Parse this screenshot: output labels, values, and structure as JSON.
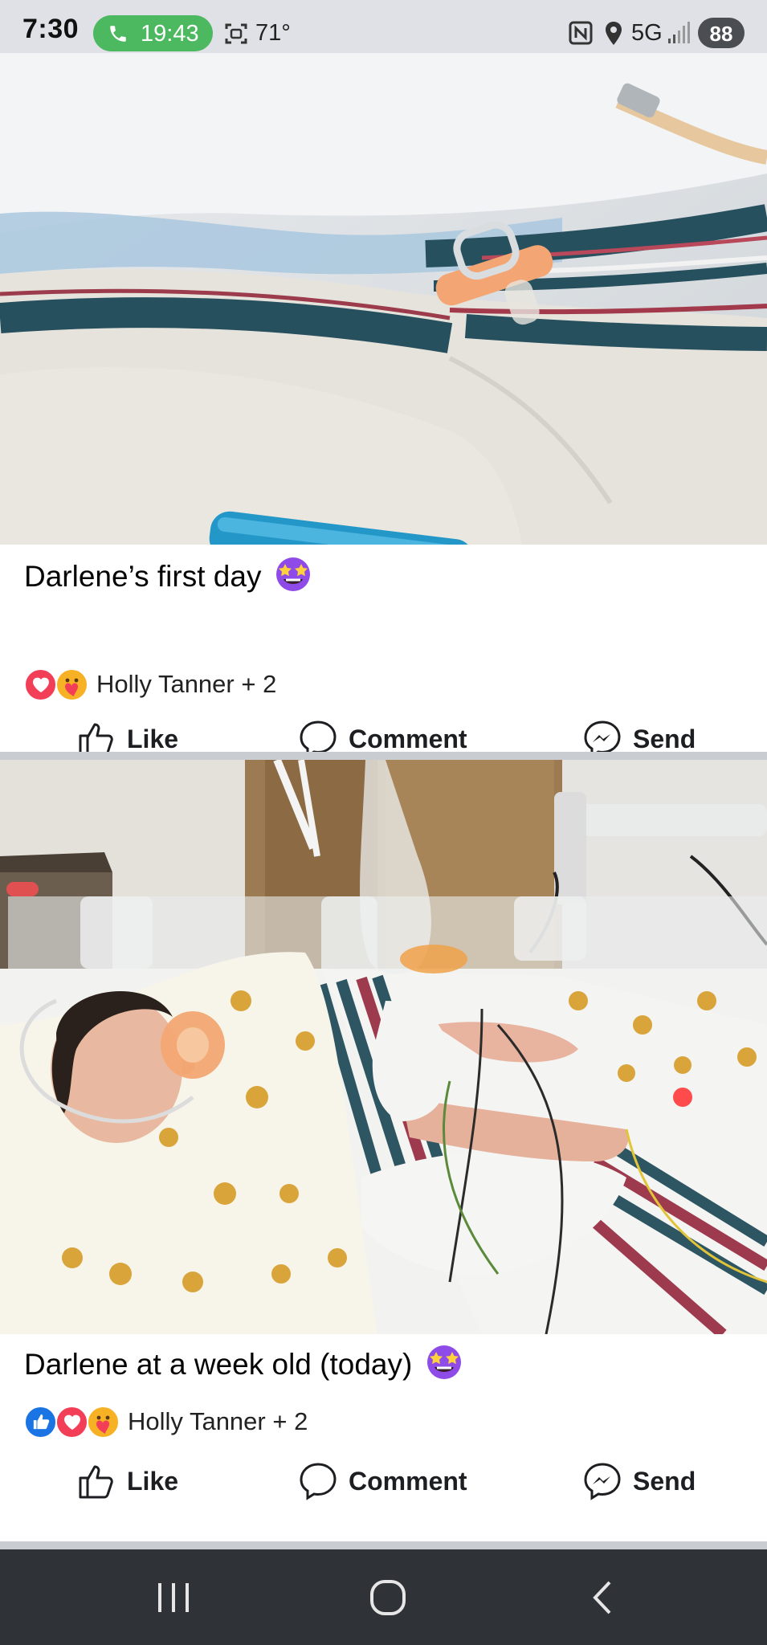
{
  "status_bar": {
    "time": "7:30",
    "call_timer": "19:43",
    "temperature": "71°",
    "network": "5G",
    "battery": "88",
    "icons": [
      "phone-icon",
      "screen-scan-icon",
      "nfc-icon",
      "location-icon",
      "signal-icon"
    ]
  },
  "posts": [
    {
      "caption": "Darlene’s first day",
      "caption_emoji": "star-struck-emoji",
      "reactions": [
        "love",
        "care"
      ],
      "reaction_names": "Holly Tanner + 2",
      "actions": {
        "like": "Like",
        "comment": "Comment",
        "send": "Send"
      }
    },
    {
      "caption": "Darlene at a week old (today)",
      "caption_emoji": "star-struck-emoji",
      "reactions": [
        "like",
        "love",
        "care"
      ],
      "reaction_names": "Holly Tanner + 2",
      "actions": {
        "like": "Like",
        "comment": "Comment",
        "send": "Send"
      }
    }
  ],
  "nav_bar": {
    "buttons": [
      "recents-icon",
      "home-icon",
      "back-icon"
    ]
  },
  "colors": {
    "status_bar_bg": "#dfe1e6",
    "call_pill": "#4cb860",
    "love": "#f33e58",
    "like": "#1b74e4",
    "care": "#f7b125",
    "divider": "#c9ccd1",
    "nav_bar_bg": "#2f3236"
  }
}
